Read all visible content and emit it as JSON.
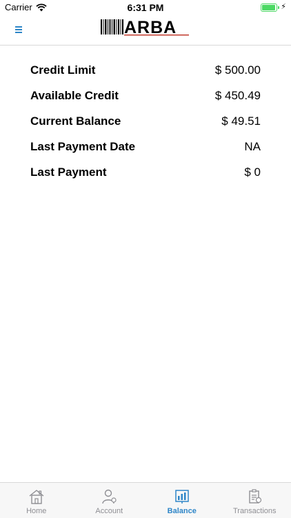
{
  "status_bar": {
    "carrier": "Carrier",
    "time": "6:31 PM"
  },
  "nav": {
    "logo_text": "ARBA"
  },
  "balances": [
    {
      "label": "Credit Limit",
      "value": "$ 500.00"
    },
    {
      "label": "Available Credit",
      "value": "$ 450.49"
    },
    {
      "label": "Current Balance",
      "value": "$ 49.51"
    },
    {
      "label": "Last Payment Date",
      "value": "NA"
    },
    {
      "label": "Last Payment",
      "value": "$ 0"
    }
  ],
  "tabs": [
    {
      "label": "Home",
      "icon": "house-icon"
    },
    {
      "label": "Account",
      "icon": "user-icon"
    },
    {
      "label": "Balance",
      "icon": "bar-chart-icon"
    },
    {
      "label": "Transactions",
      "icon": "clipboard-icon"
    }
  ],
  "active_tab": "Balance",
  "colors": {
    "accent": "#2e86c8",
    "inactive": "#8e8e93",
    "battery": "#4cd964"
  }
}
